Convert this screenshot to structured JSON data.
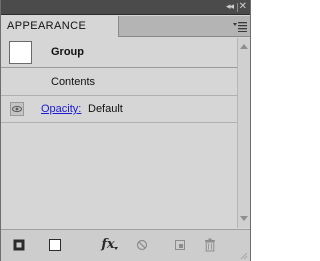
{
  "titlebar": {
    "collapse_glyph": "◂◂",
    "close_glyph": "✕"
  },
  "tab": {
    "label": "APPEARANCE"
  },
  "panel_menu_icon": "panel-menu-icon",
  "rows": {
    "group": {
      "label": "Group"
    },
    "contents": {
      "label": "Contents"
    },
    "opacity": {
      "label": "Opacity:",
      "value": "Default"
    }
  },
  "toolbar": {
    "icons": [
      "add-stroke-icon",
      "add-fill-icon",
      "add-effect-fx-icon",
      "clear-appearance-icon",
      "duplicate-item-icon",
      "delete-item-icon"
    ],
    "fx_label": "fx"
  },
  "colors": {
    "panel_bg": "#d6d6d6",
    "titlebar_bg": "#4b4b4b",
    "link_blue": "#1a1ad8"
  }
}
